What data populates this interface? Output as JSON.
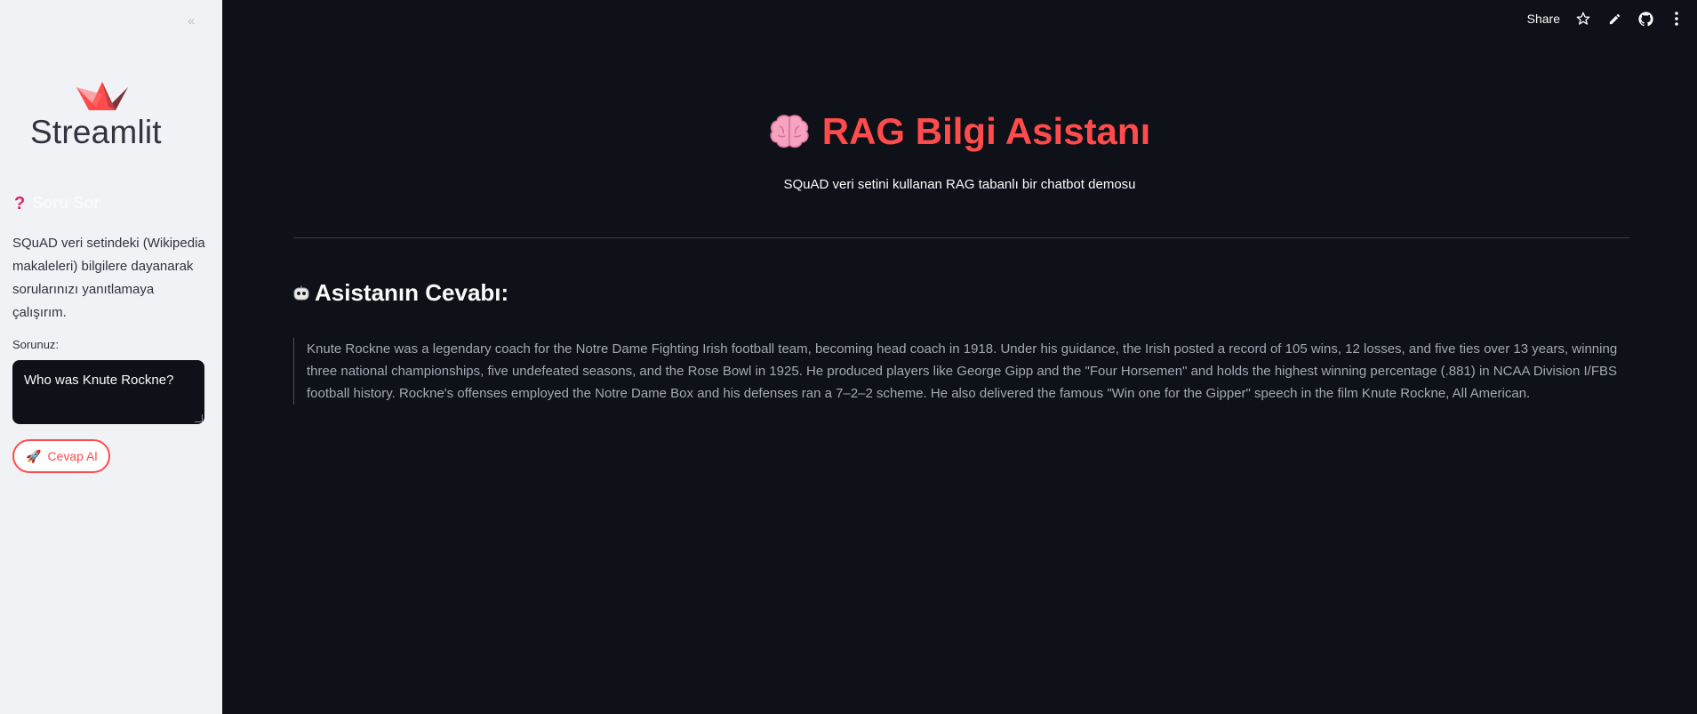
{
  "sidebar": {
    "collapse_label": "«",
    "logo_text": "Streamlit",
    "heading_icon": "question-mark-icon",
    "heading": "Soru Sor",
    "description": "SQuAD veri setindeki (Wikipedia makaleleri) bilgilere dayanarak sorularınızı yanıtlamaya çalışırım.",
    "input_label": "Sorunuz:",
    "input_value": "Who was Knute Rockne?",
    "button_icon": "rocket-icon",
    "button_label": "Cevap Al"
  },
  "toolbar": {
    "share_label": "Share",
    "icons": [
      "star-icon",
      "edit-pencil-icon",
      "github-icon",
      "more-vertical-icon"
    ]
  },
  "main": {
    "title_icon": "brain-icon",
    "title": "RAG Bilgi Asistanı",
    "subtitle": "SQuAD veri setini kullanan RAG tabanlı bir chatbot demosu",
    "answer_icon": "robot-face-icon",
    "answer_heading": "Asistanın Cevabı:",
    "answer_text": "Knute Rockne was a legendary coach for the Notre Dame Fighting Irish football team, becoming head coach in 1918. Under his guidance, the Irish posted a record of 105 wins, 12 losses, and five ties over 13 years, winning three national championships, five undefeated seasons, and the Rose Bowl in 1925. He produced players like George Gipp and the \"Four Horsemen\" and holds the highest winning percentage (.881) in NCAA Division I/FBS football history. Rockne's offenses employed the Notre Dame Box and his defenses ran a 7–2–2 scheme. He also delivered the famous \"Win one for the Gipper\" speech in the film Knute Rockne, All American."
  },
  "colors": {
    "accent": "#ff4b4b",
    "sidebar_bg": "#f0f2f6",
    "main_bg": "#0e1117"
  }
}
